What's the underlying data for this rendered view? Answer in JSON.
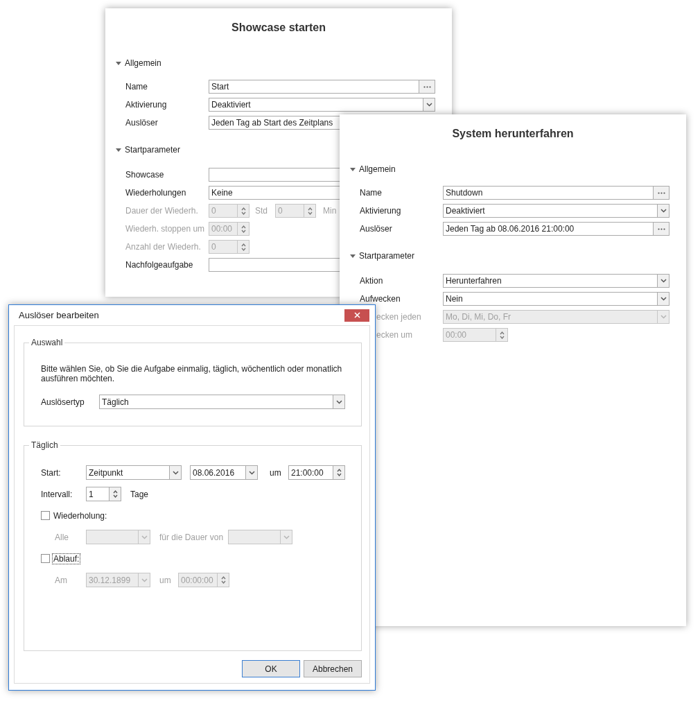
{
  "windows": [
    {
      "title": "Showcase starten",
      "sections": [
        {
          "title": "Allgemein",
          "expanded": true,
          "rows": [
            {
              "label": "Name",
              "kind": "ellipsis",
              "value": "Start",
              "disabled": false,
              "covered": false
            },
            {
              "label": "Aktivierung",
              "kind": "dropdown",
              "value": "Deaktiviert",
              "disabled": false,
              "covered": false
            },
            {
              "label": "Auslöser",
              "kind": "text",
              "value": "Jeden Tag ab Start des Zeitplans",
              "disabled": false,
              "covered": true
            }
          ]
        },
        {
          "title": "Startparameter",
          "expanded": true,
          "rows": [
            {
              "label": "Showcase",
              "kind": "text",
              "disabled": false,
              "covered": true
            },
            {
              "label": "Wiederholungen",
              "kind": "text",
              "value": "Keine",
              "disabled": false,
              "covered": true
            },
            {
              "label": "Dauer der Wiederh.",
              "kind": "spinner_pair",
              "value": "0",
              "unit": "Std",
              "value_2": "0",
              "unit_2": "Min",
              "disabled": true,
              "covered": false
            },
            {
              "label": "Wiederh. stoppen um",
              "kind": "spinner",
              "value": "00:00",
              "disabled": true,
              "covered": false
            },
            {
              "label": "Anzahl der Wiederh.",
              "kind": "spinner",
              "value": "0",
              "disabled": true,
              "covered": false
            },
            {
              "label": "Nachfolgeaufgabe",
              "kind": "text",
              "disabled": false,
              "covered": true
            }
          ]
        }
      ]
    },
    {
      "title": "System herunterfahren",
      "sections": [
        {
          "title": "Allgemein",
          "expanded": true,
          "rows": [
            {
              "label": "Name",
              "kind": "ellipsis",
              "value": "Shutdown",
              "disabled": false,
              "covered": false
            },
            {
              "label": "Aktivierung",
              "kind": "dropdown",
              "value": "Deaktiviert",
              "disabled": false,
              "covered": false
            },
            {
              "label": "Auslöser",
              "kind": "ellipsis",
              "value": "Jeden Tag ab 08.06.2016 21:00:00",
              "disabled": false,
              "covered": false
            }
          ]
        },
        {
          "title": "Startparameter",
          "expanded": true,
          "rows": [
            {
              "label": "Aktion",
              "kind": "dropdown",
              "value": "Herunterfahren",
              "disabled": false,
              "covered": false
            },
            {
              "label": "Aufwecken",
              "kind": "dropdown",
              "value": "Nein",
              "disabled": false,
              "covered": false
            },
            {
              "label": "ecken jeden",
              "label_covered": true,
              "kind": "dropdown",
              "value": "Mo, Di, Mi, Do, Fr",
              "disabled": true,
              "covered": false
            },
            {
              "label": "ecken um",
              "label_covered": true,
              "kind": "spinner",
              "value": "00:00",
              "disabled": true,
              "covered": false
            }
          ]
        }
      ]
    }
  ],
  "dialog": {
    "title": "Auslöser bearbeiten",
    "selection": {
      "title": "Auswahl",
      "description": "Bitte wählen Sie, ob Sie die Aufgabe einmalig, täglich, wöchentlich oder monatlich ausführen möchten.",
      "label": "Auslösertyp",
      "value": "Täglich"
    },
    "daily": {
      "title": "Täglich",
      "start": {
        "label": "Start:",
        "mode": "Zeitpunkt",
        "date": "08.06.2016",
        "at_label": "um",
        "time": "21:00:00"
      },
      "interval": {
        "label": "Intervall:",
        "value": "1",
        "unit": "Tage"
      },
      "repeat": {
        "label": "Wiederholung:",
        "checked": false,
        "focused": false,
        "every_label": "Alle",
        "duration_label": "für die Dauer von",
        "disabled": true
      },
      "expiry": {
        "label": "Ablauf:",
        "checked": false,
        "focused": true,
        "date_label": "Am",
        "date": "30.12.1899",
        "at_label": "um",
        "time": "00:00:00",
        "disabled": true
      }
    },
    "buttons": [
      {
        "label": "OK",
        "default": true
      },
      {
        "label": "Abbrechen",
        "default": false
      }
    ]
  }
}
